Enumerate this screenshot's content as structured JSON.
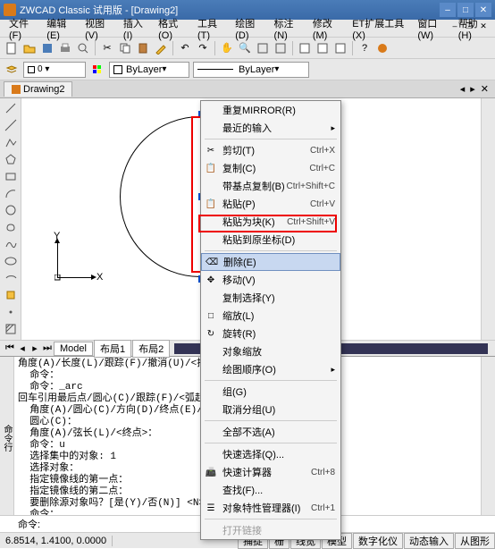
{
  "title": "ZWCAD Classic 试用版 - [Drawing2]",
  "menu": [
    "文件(F)",
    "编辑(E)",
    "视图(V)",
    "插入(I)",
    "格式(O)",
    "工具(T)",
    "绘图(D)",
    "标注(N)",
    "修改(M)",
    "ET扩展工具(X)",
    "窗口(W)",
    "帮助(H)"
  ],
  "tab": "Drawing2",
  "prop": {
    "layer": "ByLayer",
    "linetype": "ByLayer"
  },
  "axis": {
    "x": "X",
    "y": "Y"
  },
  "ctx": [
    {
      "t": "item",
      "label": "重复MIRROR(R)",
      "icon": ""
    },
    {
      "t": "item",
      "label": "最近的输入",
      "arrow": true
    },
    {
      "t": "sep"
    },
    {
      "t": "item",
      "label": "剪切(T)",
      "icon": "✂",
      "sc": "Ctrl+X"
    },
    {
      "t": "item",
      "label": "复制(C)",
      "icon": "📋",
      "sc": "Ctrl+C"
    },
    {
      "t": "item",
      "label": "带基点复制(B)",
      "sc": "Ctrl+Shift+C"
    },
    {
      "t": "item",
      "label": "粘贴(P)",
      "icon": "📋",
      "sc": "Ctrl+V"
    },
    {
      "t": "item",
      "label": "粘贴为块(K)",
      "sc": "Ctrl+Shift+V"
    },
    {
      "t": "item",
      "label": "粘贴到原坐标(D)"
    },
    {
      "t": "sep"
    },
    {
      "t": "item",
      "label": "删除(E)",
      "icon": "⌫",
      "hl": true
    },
    {
      "t": "item",
      "label": "移动(V)",
      "icon": "✥"
    },
    {
      "t": "item",
      "label": "复制选择(Y)"
    },
    {
      "t": "item",
      "label": "缩放(L)",
      "icon": "□"
    },
    {
      "t": "item",
      "label": "旋转(R)",
      "icon": "↻"
    },
    {
      "t": "item",
      "label": "对象缩放"
    },
    {
      "t": "item",
      "label": "绘图顺序(O)",
      "arrow": true
    },
    {
      "t": "sep"
    },
    {
      "t": "item",
      "label": "组(G)"
    },
    {
      "t": "item",
      "label": "取消分组(U)"
    },
    {
      "t": "sep"
    },
    {
      "t": "item",
      "label": "全部不选(A)"
    },
    {
      "t": "sep"
    },
    {
      "t": "item",
      "label": "快速选择(Q)..."
    },
    {
      "t": "item",
      "label": "快速计算器",
      "icon": "📠",
      "sc": "Ctrl+8"
    },
    {
      "t": "item",
      "label": "查找(F)..."
    },
    {
      "t": "item",
      "label": "对象特性管理器(I)",
      "icon": "☰",
      "sc": "Ctrl+1"
    },
    {
      "t": "sep"
    },
    {
      "t": "item",
      "label": "打开链接",
      "dis": true
    }
  ],
  "modeltabs": {
    "model": "Model",
    "l1": "布局1",
    "l2": "布局2"
  },
  "cmdtext": "角度(A)/长度(L)/跟踪(F)/撤消(U)/<指定\n  命令：\n  命令：_arc\n回车引用最后点/圆心(C)/跟踪(F)/<弧起\n  角度(A)/圆心(C)/方向(D)/终点(E)/半径\n  圆心(C)：\n  角度(A)/弦长(L)/<终点>：\n  命令：u\n  选择集中的对象: 1\n  选择对象：\n  指定镜像线的第一点：\n  指定镜像线的第二点：\n  要删除源对象吗？[是(Y)/否(N)] <N>:n\n  命令：\n  另一角点：",
  "cmdprompt": "命令:",
  "status": {
    "coord": "6.8514, 1.4100, 0.0000",
    "btns": [
      "捕捉",
      "栅",
      "线宽",
      "模型",
      "数字化仪",
      "动态输入",
      "从图形"
    ]
  }
}
